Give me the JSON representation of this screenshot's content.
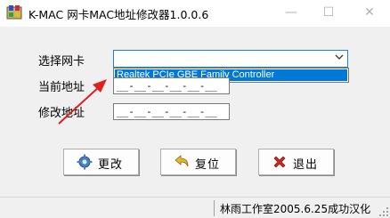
{
  "window": {
    "title": "K-MAC 网卡MAC地址修改器1.0.0.6",
    "controls": {
      "minimize": "—",
      "maximize": "☐",
      "close": "✕"
    }
  },
  "form": {
    "nic_label": "选择网卡",
    "nic_selected": "",
    "nic_options": [
      "Realtek PCIe GBE Family Controller"
    ],
    "current_label": "当前地址",
    "current_value": "__-__-__-__-__-__",
    "new_label": "修改地址",
    "new_value": "__-__-__-__-__-__"
  },
  "buttons": {
    "change": "更改",
    "reset": "复位",
    "exit": "退出"
  },
  "status": {
    "text": "林雨工作室2005.6.25成功汉化"
  },
  "colors": {
    "highlight": "#0078d7",
    "annotation_arrow": "#e02020",
    "focus_border": "#1c7fd6"
  },
  "icons": [
    "app-icon",
    "gear-icon",
    "undo-arrow-icon",
    "red-x-icon",
    "chevron-down-icon"
  ]
}
